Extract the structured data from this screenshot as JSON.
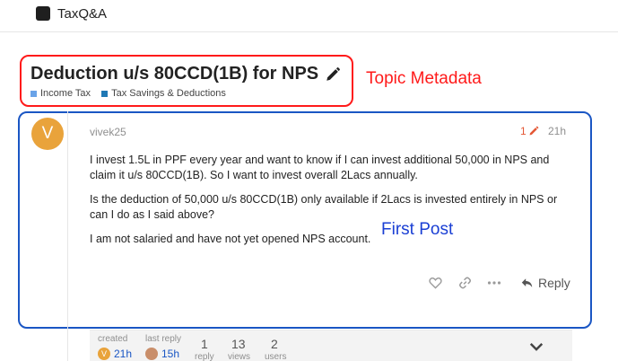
{
  "site": {
    "title": "TaxQ&A"
  },
  "topic": {
    "title": "Deduction u/s 80CCD(1B) for NPS",
    "categories": [
      {
        "name": "Income Tax",
        "color": "#6aa3e8"
      },
      {
        "name": "Tax Savings & Deductions",
        "color": "#1f78b4"
      }
    ]
  },
  "annotations": {
    "topic_metadata": "Topic Metadata",
    "first_post": "First Post"
  },
  "post": {
    "avatar_letter": "V",
    "username": "vivek25",
    "edit_count": "1",
    "time": "21h",
    "paragraphs": [
      "I invest 1.5L in PPF every year and want to know if I can invest additional 50,000 in NPS and claim it u/s 80CCD(1B). So I want to invest overall 2Lacs annually.",
      "Is the deduction of 50,000 u/s 80CCD(1B) only available if 2Lacs is invested entirely in NPS or can I do as I said above?",
      "I am not salaried and have not yet opened NPS account."
    ],
    "actions": {
      "reply_label": "Reply"
    }
  },
  "topic_map": {
    "created_label": "created",
    "created_avatar_letter": "V",
    "created_time": "21h",
    "last_reply_label": "last reply",
    "last_reply_time": "15h",
    "replies_count": "1",
    "replies_label": "reply",
    "views_count": "13",
    "views_label": "views",
    "users_count": "2",
    "users_label": "users"
  },
  "colors": {
    "accent": "#e45735",
    "avatar": "#e9a33b",
    "red_annotation": "#ff1a1a",
    "blue_annotation": "#1a56c4"
  }
}
